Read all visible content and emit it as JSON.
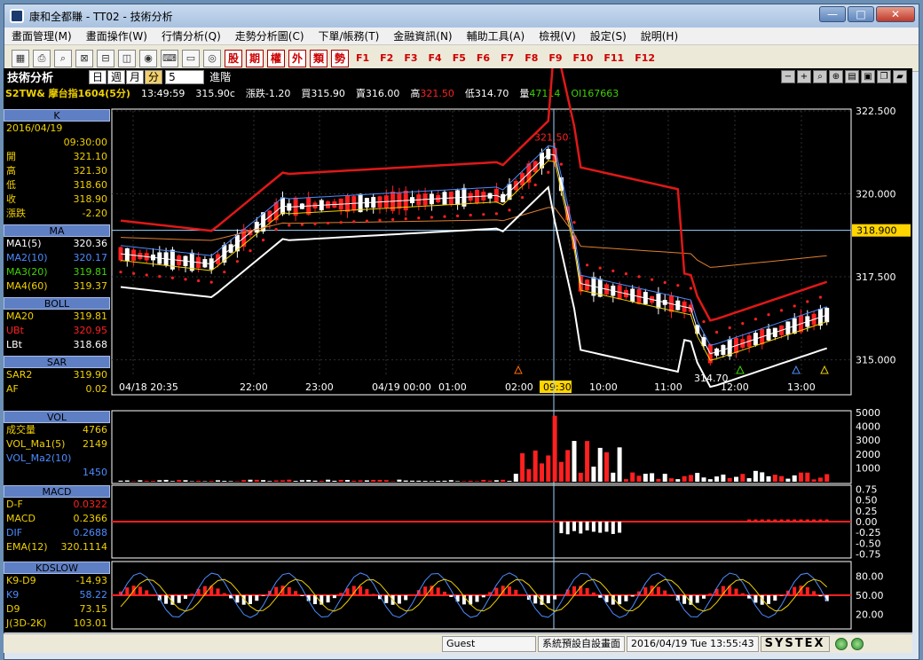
{
  "window": {
    "title": "康和全都賺 - TT02 - 技術分析"
  },
  "menu": [
    "畫面管理(M)",
    "畫面操作(W)",
    "行情分析(Q)",
    "走勢分析圖(C)",
    "下單/帳務(T)",
    "金融資訊(N)",
    "輔助工具(A)",
    "檢視(V)",
    "設定(S)",
    "說明(H)"
  ],
  "toolbar": {
    "red_buttons": [
      "股",
      "期",
      "權",
      "外",
      "類",
      "勢"
    ],
    "fkeys": [
      "F1",
      "F2",
      "F3",
      "F4",
      "F5",
      "F6",
      "F7",
      "F8",
      "F9",
      "F10",
      "F11",
      "F12"
    ]
  },
  "chart_header": {
    "title": "技術分析",
    "periods": [
      "日",
      "週",
      "月",
      "分"
    ],
    "active_period": "分",
    "interval": "5",
    "advanced": "進階",
    "symbol": "S2TW& 摩台指1604(5分)",
    "time": "13:49:59",
    "last": "315.90c",
    "change": "漲跌-1.20",
    "bid": "買315.90",
    "ask": "賣316.00",
    "high_label": "高",
    "high": "321.50",
    "low": "低314.70",
    "vol_label": "量",
    "vol": "47114",
    "oi": "OI167663"
  },
  "panels": {
    "k": {
      "title": "K",
      "date": "2016/04/19",
      "time": "09:30:00",
      "rows": [
        {
          "k": "開",
          "v": "321.10"
        },
        {
          "k": "高",
          "v": "321.30"
        },
        {
          "k": "低",
          "v": "318.60"
        },
        {
          "k": "收",
          "v": "318.90"
        },
        {
          "k": "漲跌",
          "v": "-2.20"
        }
      ]
    },
    "ma": {
      "title": "MA",
      "rows": [
        {
          "k": "MA1(5)",
          "v": "320.36"
        },
        {
          "k": "MA2(10)",
          "v": "320.17"
        },
        {
          "k": "MA3(20)",
          "v": "319.81"
        },
        {
          "k": "MA4(60)",
          "v": "319.37"
        }
      ]
    },
    "boll": {
      "title": "BOLL",
      "rows": [
        {
          "k": "MA20",
          "v": "319.81"
        },
        {
          "k": "UBt",
          "v": "320.95"
        },
        {
          "k": "LBt",
          "v": "318.68"
        }
      ]
    },
    "sar": {
      "title": "SAR",
      "rows": [
        {
          "k": "SAR2",
          "v": "319.90"
        },
        {
          "k": "AF",
          "v": "0.02"
        }
      ]
    },
    "vol": {
      "title": "VOL",
      "rows": [
        {
          "k": "成交量",
          "v": "4766"
        },
        {
          "k": "VOL_Ma1(5)",
          "v": "2149"
        },
        {
          "k": "VOL_Ma2(10)",
          "v": ""
        },
        {
          "k": "",
          "v": "1450"
        }
      ]
    },
    "macd": {
      "title": "MACD",
      "rows": [
        {
          "k": "D-F",
          "v": "0.0322"
        },
        {
          "k": "MACD",
          "v": "0.2366"
        },
        {
          "k": "DIF",
          "v": "0.2688"
        },
        {
          "k": "EMA(12)",
          "v": "320.1114"
        }
      ]
    },
    "kd": {
      "title": "KDSLOW",
      "rows": [
        {
          "k": "K9-D9",
          "v": "-14.93"
        },
        {
          "k": "K9",
          "v": "58.22"
        },
        {
          "k": "D9",
          "v": "73.15"
        },
        {
          "k": "J(3D-2K)",
          "v": "103.01"
        }
      ]
    }
  },
  "axes": {
    "price_ticks": [
      "322.500",
      "320.000",
      "317.500",
      "315.000"
    ],
    "price_marker": "318.900",
    "time_ticks": [
      "04/18 20:35",
      "22:00",
      "23:00",
      "04/19 00:00",
      "01:00",
      "02:00",
      "09:30",
      "10:00",
      "11:00",
      "12:00",
      "13:00"
    ],
    "vol_ticks": [
      "5000",
      "4000",
      "3000",
      "2000",
      "1000"
    ],
    "macd_ticks": [
      "0.75",
      "0.50",
      "0.25",
      "0.00",
      "-0.25",
      "-0.50",
      "-0.75"
    ],
    "kd_ticks": [
      "80.00",
      "50.00",
      "20.00"
    ],
    "annotations": {
      "high": "321.50",
      "low": "314.70"
    }
  },
  "status": {
    "user": "Guest",
    "layout": "系統預設自設畫面",
    "datetime": "2016/04/19 Tue 13:55:43",
    "brand": "SYSTEX"
  },
  "colors": {
    "up": "#ff2020",
    "down": "#ffffff",
    "boll": "#e01818",
    "sar": "#ff2020",
    "marker": "#ffd400",
    "panel_header": "#5f7fc4"
  }
}
